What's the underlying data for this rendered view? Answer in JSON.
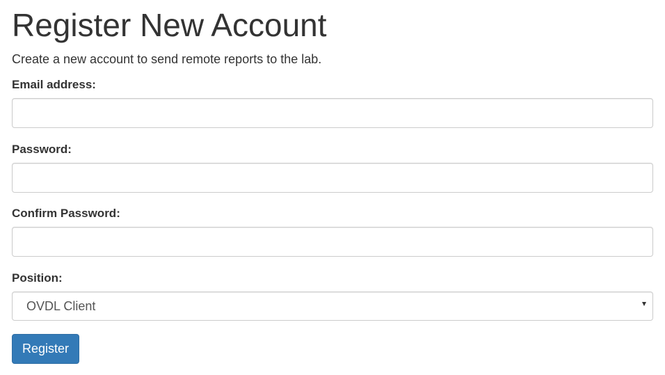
{
  "page": {
    "title": "Register New Account",
    "subtitle": "Create a new account to send remote reports to the lab."
  },
  "form": {
    "email": {
      "label": "Email address:",
      "value": "",
      "placeholder": ""
    },
    "password": {
      "label": "Password:",
      "value": "",
      "placeholder": ""
    },
    "confirm_password": {
      "label": "Confirm Password:",
      "value": "",
      "placeholder": ""
    },
    "position": {
      "label": "Position:",
      "selected": "OVDL Client",
      "icon": "chevron-down-icon"
    },
    "submit_label": "Register"
  },
  "colors": {
    "primary_button": "#337ab7",
    "primary_button_border": "#2e6da4",
    "text": "#333333",
    "input_border": "#cccccc"
  }
}
